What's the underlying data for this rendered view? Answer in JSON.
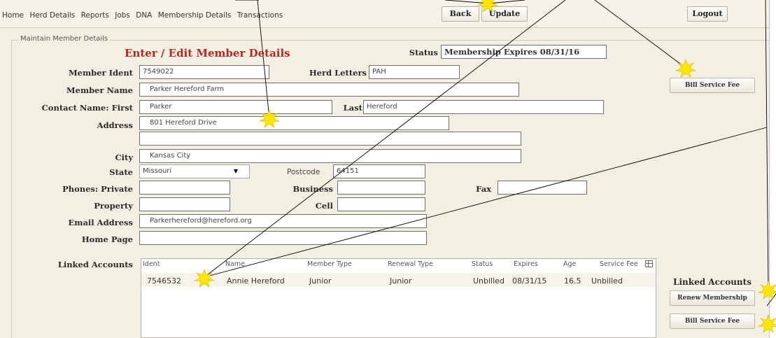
{
  "menu": [
    "Home",
    "Herd Details",
    "Reports",
    "Jobs",
    "DNA",
    "Membership Details",
    "Transactions"
  ],
  "toolbar": {
    "back": "Back",
    "update": "Update",
    "logout": "Logout"
  },
  "panel": {
    "legend": "Maintain Member Details",
    "heading": "Enter / Edit Member Details"
  },
  "form": {
    "status_label": "Status",
    "status_value": "Membership Expires 08/31/16",
    "member_ident_label": "Member Ident",
    "member_ident": "7549022",
    "herd_letters_label": "Herd Letters",
    "herd_letters": "PAH",
    "member_name_label": "Member Name",
    "member_name": "Parker Hereford Farm",
    "contact_first_label": "Contact Name: First",
    "contact_first": "Parker",
    "last_label": "Last",
    "last": "Hereford",
    "address_label": "Address",
    "address1": "801 Hereford Drive",
    "address2": "",
    "city_label": "City",
    "city": "Kansas City",
    "state_label": "State",
    "state": "Missouri",
    "postcode_label": "Postcode",
    "postcode": "64151",
    "phones_label": "Phones: Private",
    "phone_private": "",
    "business_label": "Business",
    "business": "",
    "fax_label": "Fax",
    "fax": "",
    "property_label": "Property",
    "property": "",
    "cell_label": "Cell",
    "cell": "",
    "email_label": "Email Address",
    "email": "Parkerhereford@hereford.org",
    "homepage_label": "Home Page",
    "homepage": ""
  },
  "buttons": {
    "bill_service_fee_top": "Bill Service Fee",
    "linked_title": "Linked Accounts",
    "renew_membership": "Renew Membership",
    "bill_service_fee_bottom": "Bill Service Fee"
  },
  "linked": {
    "label": "Linked Accounts",
    "headers": [
      "Ident",
      "Name",
      "Member Type",
      "Renewal Type",
      "Status",
      "Expires",
      "Age",
      "Service Fee"
    ],
    "rows": [
      [
        "7546532",
        "Annie Hereford",
        "Junior",
        "Junior",
        "Unbilled",
        "08/31/15",
        "16.5",
        "Unbilled"
      ]
    ]
  },
  "colors": {
    "heading": "#b02a27",
    "background": "#f3efe2",
    "star": "#ffe600"
  }
}
